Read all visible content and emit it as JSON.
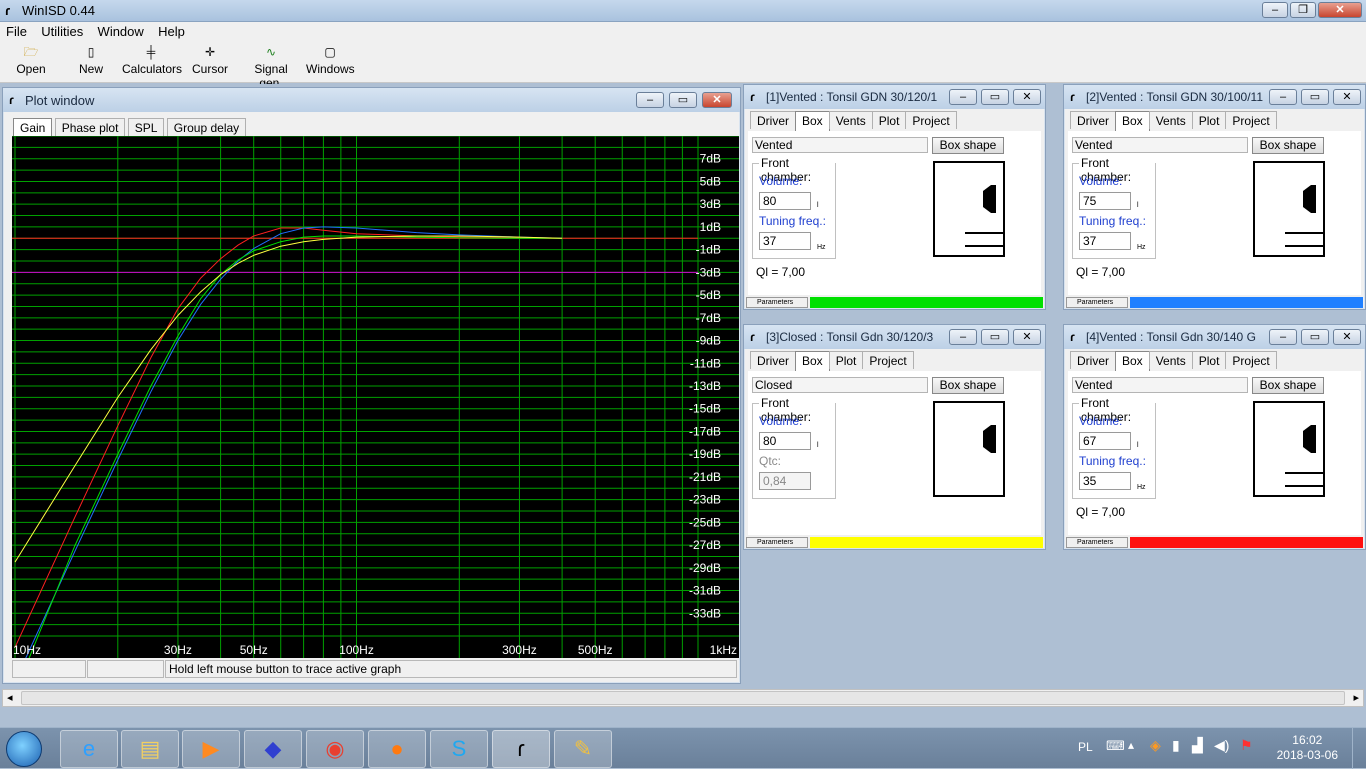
{
  "app": {
    "title": "WinISD 0.44"
  },
  "menu": [
    "File",
    "Utilities",
    "Window",
    "Help"
  ],
  "toolbar": [
    {
      "label": "Open",
      "icon": "folder-icon"
    },
    {
      "label": "New",
      "icon": "new-document-icon"
    },
    {
      "label": "Calculators",
      "icon": "calculator-icon"
    },
    {
      "label": "Cursor",
      "icon": "cursor-icon"
    },
    {
      "label": "Signal gen.",
      "icon": "signal-generator-icon"
    },
    {
      "label": "Windows",
      "icon": "windows-icon"
    }
  ],
  "plot": {
    "title": "Plot window",
    "tabs": [
      "Gain",
      "Phase plot",
      "SPL",
      "Group delay"
    ],
    "active_tab": "Gain",
    "status": "Hold left mouse button to trace active graph"
  },
  "chart_data": {
    "type": "line",
    "x_scale": "log",
    "xlim": [
      10,
      1000
    ],
    "ylim": [
      -35,
      9
    ],
    "grid": true,
    "x_ticks": [
      {
        "value": 10,
        "label": "10Hz"
      },
      {
        "value": 30,
        "label": "30Hz"
      },
      {
        "value": 50,
        "label": "50Hz"
      },
      {
        "value": 100,
        "label": "100Hz"
      },
      {
        "value": 300,
        "label": "300Hz"
      },
      {
        "value": 500,
        "label": "500Hz"
      },
      {
        "value": 1000,
        "label": "1kHz"
      }
    ],
    "y_ticks": [
      {
        "value": 7,
        "label": "7dB"
      },
      {
        "value": 5,
        "label": "5dB"
      },
      {
        "value": 3,
        "label": "3dB"
      },
      {
        "value": 1,
        "label": "1dB"
      },
      {
        "value": -1,
        "label": "-1dB"
      },
      {
        "value": -3,
        "label": "-3dB"
      },
      {
        "value": -5,
        "label": "-5dB"
      },
      {
        "value": -7,
        "label": "-7dB"
      },
      {
        "value": -9,
        "label": "-9dB"
      },
      {
        "value": -11,
        "label": "-11dB"
      },
      {
        "value": -13,
        "label": "-13dB"
      },
      {
        "value": -15,
        "label": "-15dB"
      },
      {
        "value": -17,
        "label": "-17dB"
      },
      {
        "value": -19,
        "label": "-19dB"
      },
      {
        "value": -21,
        "label": "-21dB"
      },
      {
        "value": -23,
        "label": "-23dB"
      },
      {
        "value": -25,
        "label": "-25dB"
      },
      {
        "value": -27,
        "label": "-27dB"
      },
      {
        "value": -29,
        "label": "-29dB"
      },
      {
        "value": -31,
        "label": "-31dB"
      },
      {
        "value": -33,
        "label": "-33dB"
      }
    ],
    "reference_lines": [
      {
        "y": 0,
        "color": "#ff2020"
      },
      {
        "y": -3,
        "color": "#d000d0"
      }
    ],
    "series": [
      {
        "color": "#ff2020",
        "x": [
          10,
          15,
          20,
          25,
          30,
          35,
          40,
          45,
          50,
          60,
          70,
          80,
          100,
          150,
          200,
          300,
          400
        ],
        "y": [
          -36,
          -24.5,
          -16.5,
          -10.5,
          -6.2,
          -3.5,
          -1.8,
          -0.6,
          0.2,
          0.9,
          0.9,
          0.7,
          0.4,
          0.2,
          0.1,
          0.05,
          0
        ]
      },
      {
        "color": "#2070ff",
        "x": [
          10,
          15,
          20,
          25,
          30,
          35,
          40,
          45,
          50,
          60,
          70,
          80,
          100,
          150,
          200,
          300,
          400
        ],
        "y": [
          -39,
          -27.5,
          -19.5,
          -13.5,
          -9,
          -5.8,
          -3.6,
          -2,
          -0.9,
          0.4,
          0.9,
          1,
          0.9,
          0.5,
          0.3,
          0.1,
          0
        ]
      },
      {
        "color": "#00e000",
        "x": [
          10,
          15,
          20,
          25,
          30,
          35,
          40,
          45,
          50,
          60,
          70,
          80,
          100,
          150,
          200,
          300,
          400
        ],
        "y": [
          -40,
          -27,
          -19,
          -13,
          -8.6,
          -5.3,
          -3.2,
          -1.9,
          -1.1,
          -0.3,
          0.1,
          0.2,
          0.2,
          0.1,
          0.05,
          0,
          0
        ]
      },
      {
        "color": "#ffff40",
        "x": [
          10,
          15,
          20,
          25,
          30,
          35,
          40,
          45,
          50,
          60,
          70,
          80,
          100,
          150,
          200,
          300,
          400
        ],
        "y": [
          -28.5,
          -20,
          -14,
          -9.8,
          -6.8,
          -4.7,
          -3.2,
          -2.2,
          -1.5,
          -0.7,
          -0.3,
          -0.1,
          0.1,
          0.2,
          0.2,
          0.1,
          0
        ]
      }
    ]
  },
  "projects": [
    {
      "title": "[1]Vented : Tonsil GDN 30/120/1",
      "tabs": [
        "Driver",
        "Box",
        "Vents",
        "Plot",
        "Project"
      ],
      "box_type": "Vented",
      "box_shape_button": "Box shape",
      "group_label": "Front chamber:",
      "volume_label": "Volume:",
      "volume": "80",
      "volume_unit": "l",
      "second_label": "Tuning freq.:",
      "second_value": "37",
      "second_unit": "Hz",
      "ql": "Ql = 7,00",
      "params_label": "Parameters",
      "color": "#00e000"
    },
    {
      "title": "[2]Vented : Tonsil GDN 30/100/11",
      "tabs": [
        "Driver",
        "Box",
        "Vents",
        "Plot",
        "Project"
      ],
      "box_type": "Vented",
      "box_shape_button": "Box shape",
      "group_label": "Front chamber:",
      "volume_label": "Volume:",
      "volume": "75",
      "volume_unit": "l",
      "second_label": "Tuning freq.:",
      "second_value": "37",
      "second_unit": "Hz",
      "ql": "Ql = 7,00",
      "params_label": "Parameters",
      "color": "#2080ff"
    },
    {
      "title": "[3]Closed : Tonsil Gdn 30/120/3",
      "tabs": [
        "Driver",
        "Box",
        "Plot",
        "Project"
      ],
      "box_type": "Closed",
      "box_shape_button": "Box shape",
      "group_label": "Front chamber:",
      "volume_label": "Volume:",
      "volume": "80",
      "volume_unit": "l",
      "second_label": "Qtc:",
      "second_value": "0,84",
      "second_unit": "",
      "ql": "",
      "params_label": "Parameters",
      "color": "#ffff00"
    },
    {
      "title": "[4]Vented : Tonsil Gdn 30/140 G",
      "tabs": [
        "Driver",
        "Box",
        "Vents",
        "Plot",
        "Project"
      ],
      "box_type": "Vented",
      "box_shape_button": "Box shape",
      "group_label": "Front chamber:",
      "volume_label": "Volume:",
      "volume": "67",
      "volume_unit": "l",
      "second_label": "Tuning freq.:",
      "second_value": "35",
      "second_unit": "Hz",
      "ql": "Ql = 7,00",
      "params_label": "Parameters",
      "color": "#ff1010"
    }
  ],
  "taskbar": {
    "apps": [
      "start-orb-icon",
      "internet-explorer-icon",
      "file-explorer-icon",
      "media-player-icon",
      "app-icon",
      "chrome-icon",
      "firefox-icon",
      "skype-icon",
      "winisd-icon",
      "paint-icon"
    ],
    "language": "PL",
    "time": "16:02",
    "date": "2018-03-06"
  }
}
